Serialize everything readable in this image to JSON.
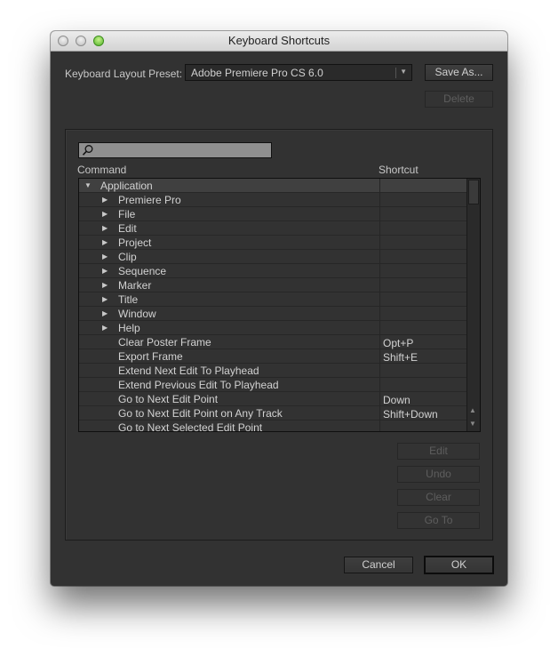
{
  "window": {
    "title": "Keyboard Shortcuts",
    "controls": [
      "close-button",
      "minimize-button",
      "zoom-button"
    ]
  },
  "preset": {
    "label": "Keyboard Layout Preset:",
    "value": "Adobe Premiere Pro CS 6.0",
    "save_as_label": "Save As...",
    "delete_label": "Delete"
  },
  "search": {
    "value": "",
    "placeholder": "",
    "icon": "search-icon"
  },
  "table": {
    "columns": [
      "Command",
      "Shortcut"
    ],
    "rows": [
      {
        "command": "Application",
        "shortcut": "",
        "level": 0,
        "expander": "expanded",
        "selected": true
      },
      {
        "command": "Premiere Pro",
        "shortcut": "",
        "level": 1,
        "expander": "collapsed"
      },
      {
        "command": "File",
        "shortcut": "",
        "level": 1,
        "expander": "collapsed"
      },
      {
        "command": "Edit",
        "shortcut": "",
        "level": 1,
        "expander": "collapsed"
      },
      {
        "command": "Project",
        "shortcut": "",
        "level": 1,
        "expander": "collapsed"
      },
      {
        "command": "Clip",
        "shortcut": "",
        "level": 1,
        "expander": "collapsed"
      },
      {
        "command": "Sequence",
        "shortcut": "",
        "level": 1,
        "expander": "collapsed"
      },
      {
        "command": "Marker",
        "shortcut": "",
        "level": 1,
        "expander": "collapsed"
      },
      {
        "command": "Title",
        "shortcut": "",
        "level": 1,
        "expander": "collapsed"
      },
      {
        "command": "Window",
        "shortcut": "",
        "level": 1,
        "expander": "collapsed"
      },
      {
        "command": "Help",
        "shortcut": "",
        "level": 1,
        "expander": "collapsed"
      },
      {
        "command": "Clear Poster Frame",
        "shortcut": "Opt+P",
        "level": 1,
        "expander": "none"
      },
      {
        "command": "Export Frame",
        "shortcut": "Shift+E",
        "level": 1,
        "expander": "none"
      },
      {
        "command": "Extend Next Edit To Playhead",
        "shortcut": "",
        "level": 1,
        "expander": "none"
      },
      {
        "command": "Extend Previous Edit To Playhead",
        "shortcut": "",
        "level": 1,
        "expander": "none"
      },
      {
        "command": "Go to Next Edit Point",
        "shortcut": "Down",
        "level": 1,
        "expander": "none"
      },
      {
        "command": "Go to Next Edit Point on Any Track",
        "shortcut": "Shift+Down",
        "level": 1,
        "expander": "none"
      },
      {
        "command": "Go to Next Selected Edit Point",
        "shortcut": "",
        "level": 1,
        "expander": "none"
      }
    ]
  },
  "side_buttons": {
    "edit_label": "Edit",
    "undo_label": "Undo",
    "clear_label": "Clear",
    "goto_label": "Go To"
  },
  "footer": {
    "cancel_label": "Cancel",
    "ok_label": "OK"
  },
  "colors": {
    "dialog_bg": "#323232",
    "titlebar_bg": "#dcdcdc",
    "search_bg": "#8f8f8f",
    "selected_row": "#404040"
  }
}
